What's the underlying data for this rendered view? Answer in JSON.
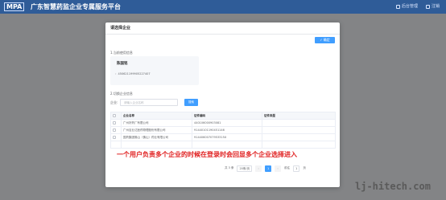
{
  "header": {
    "logo": "MPA",
    "title": "广东智慧药监企业专属服务平台",
    "right_items": [
      "后台管理",
      "注销"
    ]
  },
  "modal": {
    "title": "请选择企业",
    "confirm_label": "✓ 确定",
    "current_section": "1.当前使用信息",
    "current_company": {
      "name": "陈国铭",
      "code": "：450621199905227407"
    },
    "select_section": "2.切换企业信息",
    "search": {
      "label": "企业:",
      "placeholder": "请输入企业名称",
      "button": "搜索"
    },
    "table": {
      "columns": [
        "",
        "企业名称",
        "证件编码",
        "证件类型"
      ],
      "rows": [
        {
          "name": "广州好药厂有限公司",
          "code": "440106000903081",
          "type": ""
        },
        {
          "name": "广州百业达医药物理股份有限公司",
          "code": "91440101190451146",
          "type": ""
        },
        {
          "name": "国药集团佛山（佛山）药业有限公司",
          "code": "91440600707953315X",
          "type": ""
        }
      ]
    },
    "annotation": "一个用户负责多个企业的时候在登录时会回显多个企业选择进入",
    "pagination": {
      "total": "共 3 条",
      "page_size": "20条/页",
      "prev": "‹",
      "current_page": "1",
      "next": "›",
      "goto_label": "前往",
      "goto_value": "1",
      "page_suffix": "页"
    }
  },
  "watermark": "lj-hitech.com",
  "colors": {
    "header_bg": "#2f5c98",
    "primary": "#409eff",
    "annotation": "#e02020"
  }
}
